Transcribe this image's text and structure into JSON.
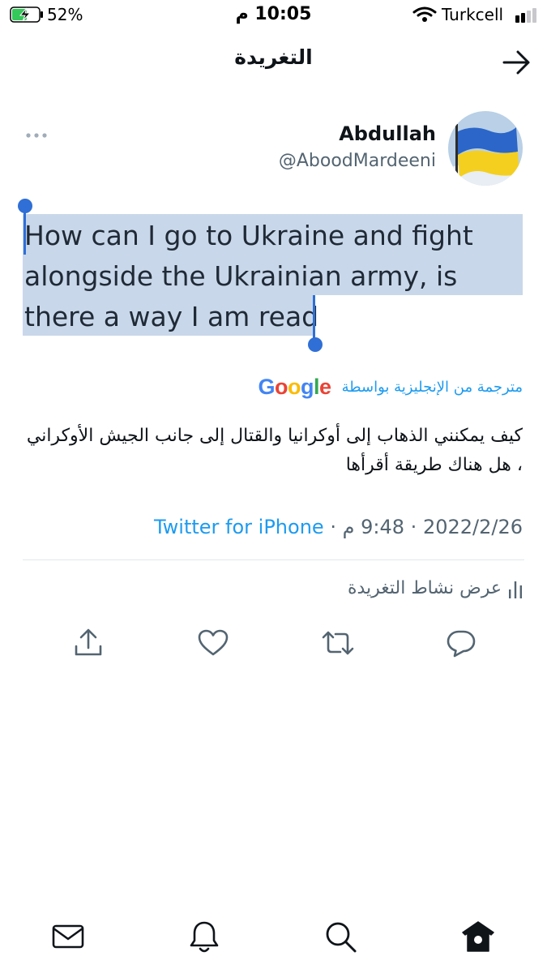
{
  "status_bar": {
    "battery_percent": "52%",
    "time": "10:05 م",
    "carrier": "Turkcell"
  },
  "header": {
    "title": "التغريدة"
  },
  "tweet": {
    "author_name": "Abdullah",
    "author_handle": "@AboodMardeeni",
    "text_lines": [
      "How can I go to Ukraine and fight",
      "alongside the Ukrainian army, is",
      "there a way I am read"
    ],
    "translated_label": "مترجمة من الإنجليزية بواسطة",
    "translated_text": "كيف يمكنني الذهاب إلى أوكرانيا والقتال إلى جانب الجيش الأوكراني ، هل هناك طريقة أقرأها",
    "date": "2022/2/26",
    "time": "9:48 م",
    "source": "Twitter for iPhone",
    "separator": "·",
    "activity_label": "عرض نشاط التغريدة"
  },
  "google_logo": {
    "letters": [
      "G",
      "o",
      "o",
      "g",
      "l",
      "e"
    ]
  },
  "icons": {
    "back": "arrow-right-icon",
    "more": "more-horizontal-icon",
    "activity": "bar-chart-icon",
    "actions": [
      "share-icon",
      "like-icon",
      "retweet-icon",
      "reply-icon"
    ],
    "tabs": [
      "messages-icon",
      "notifications-icon",
      "search-icon",
      "home-icon"
    ]
  },
  "colors": {
    "accent": "#1d9bf0",
    "selection": "#c9d7ea",
    "selection_handle": "#2f6fd6",
    "muted_text": "#536471"
  }
}
